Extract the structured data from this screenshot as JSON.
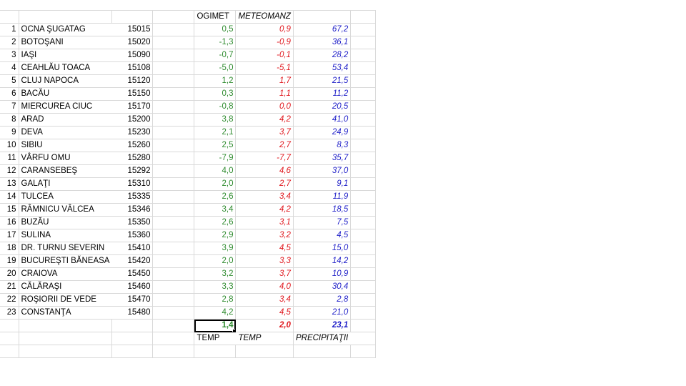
{
  "header": {
    "ogimet": "OGIMET",
    "meteomanz": "METEOMANZ"
  },
  "rows": [
    {
      "num": "1",
      "name": "OCNA ŞUGATAG",
      "code": "15015",
      "ogimet": "0,5",
      "meteomanz": "0,9",
      "precip": "67,2"
    },
    {
      "num": "2",
      "name": "BOTOŞANI",
      "code": "15020",
      "ogimet": "-1,3",
      "meteomanz": "-0,9",
      "precip": "36,1"
    },
    {
      "num": "3",
      "name": "IAŞI",
      "code": "15090",
      "ogimet": "-0,7",
      "meteomanz": "-0,1",
      "precip": "28,2"
    },
    {
      "num": "4",
      "name": "CEAHLĂU TOACA",
      "code": "15108",
      "ogimet": "-5,0",
      "meteomanz": "-5,1",
      "precip": "53,4"
    },
    {
      "num": "5",
      "name": "CLUJ NAPOCA",
      "code": "15120",
      "ogimet": "1,2",
      "meteomanz": "1,7",
      "precip": "21,5"
    },
    {
      "num": "6",
      "name": "BACĂU",
      "code": "15150",
      "ogimet": "0,3",
      "meteomanz": "1,1",
      "precip": "11,2"
    },
    {
      "num": "7",
      "name": "MIERCUREA CIUC",
      "code": "15170",
      "ogimet": "-0,8",
      "meteomanz": "0,0",
      "precip": "20,5"
    },
    {
      "num": "8",
      "name": "ARAD",
      "code": "15200",
      "ogimet": "3,8",
      "meteomanz": "4,2",
      "precip": "41,0"
    },
    {
      "num": "9",
      "name": "DEVA",
      "code": "15230",
      "ogimet": "2,1",
      "meteomanz": "3,7",
      "precip": "24,9"
    },
    {
      "num": "10",
      "name": "SIBIU",
      "code": "15260",
      "ogimet": "2,5",
      "meteomanz": "2,7",
      "precip": "8,3"
    },
    {
      "num": "11",
      "name": "VÂRFU OMU",
      "code": "15280",
      "ogimet": "-7,9",
      "meteomanz": "-7,7",
      "precip": "35,7"
    },
    {
      "num": "12",
      "name": "CARANSEBEŞ",
      "code": "15292",
      "ogimet": "4,0",
      "meteomanz": "4,6",
      "precip": "37,0"
    },
    {
      "num": "13",
      "name": "GALAŢI",
      "code": "15310",
      "ogimet": "2,0",
      "meteomanz": "2,7",
      "precip": "9,1"
    },
    {
      "num": "14",
      "name": "TULCEA",
      "code": "15335",
      "ogimet": "2,6",
      "meteomanz": "3,4",
      "precip": "11,9"
    },
    {
      "num": "15",
      "name": "RÂMNICU VÂLCEA",
      "code": "15346",
      "ogimet": "3,4",
      "meteomanz": "4,2",
      "precip": "18,5"
    },
    {
      "num": "16",
      "name": "BUZĂU",
      "code": "15350",
      "ogimet": "2,6",
      "meteomanz": "3,1",
      "precip": "7,5"
    },
    {
      "num": "17",
      "name": "SULINA",
      "code": "15360",
      "ogimet": "2,9",
      "meteomanz": "3,2",
      "precip": "4,5"
    },
    {
      "num": "18",
      "name": "DR. TURNU SEVERIN",
      "code": "15410",
      "ogimet": "3,9",
      "meteomanz": "4,5",
      "precip": "15,0"
    },
    {
      "num": "19",
      "name": "BUCUREŞTI BĂNEASA",
      "code": "15420",
      "ogimet": "2,0",
      "meteomanz": "3,3",
      "precip": "14,2"
    },
    {
      "num": "20",
      "name": "CRAIOVA",
      "code": "15450",
      "ogimet": "3,2",
      "meteomanz": "3,7",
      "precip": "10,9"
    },
    {
      "num": "21",
      "name": "CĂLĂRAŞI",
      "code": "15460",
      "ogimet": "3,3",
      "meteomanz": "4,0",
      "precip": "30,4"
    },
    {
      "num": "22",
      "name": "ROŞIORII DE VEDE",
      "code": "15470",
      "ogimet": "2,8",
      "meteomanz": "3,4",
      "precip": "2,8"
    },
    {
      "num": "23",
      "name": "CONSTANŢA",
      "code": "15480",
      "ogimet": "4,2",
      "meteomanz": "4,5",
      "precip": "21,0"
    }
  ],
  "totals": {
    "ogimet": "1,4",
    "meteomanz": "2,0",
    "precip": "23,1"
  },
  "footer": {
    "ogimet": "TEMP",
    "meteomanz": "TEMP",
    "precip": "PRECIPITAŢII"
  },
  "colors": {
    "ogimet": "#2e8b2e",
    "meteomanz": "#e0191f",
    "precip": "#1f1fc8",
    "gridline": "#d9d9d9"
  }
}
